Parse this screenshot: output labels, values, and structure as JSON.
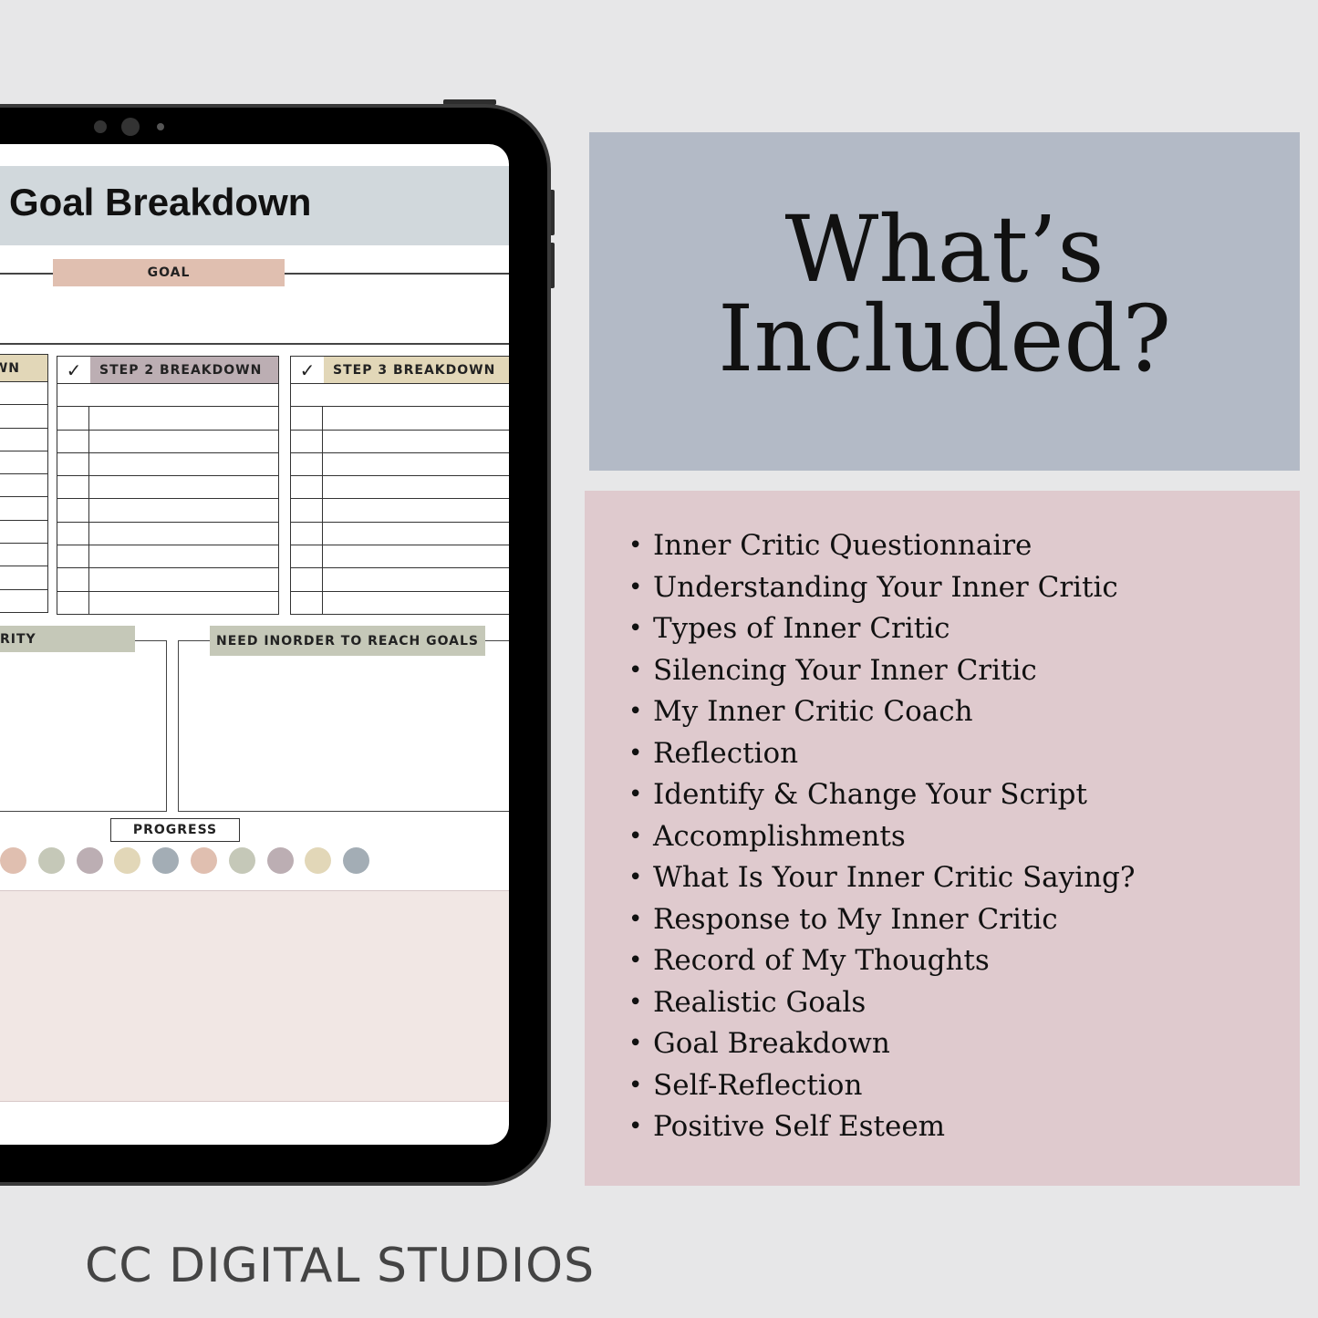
{
  "tablet_page": {
    "title": "Goal Breakdown",
    "goal_label": "GOAL",
    "steps": [
      {
        "label": "WN",
        "check": "✓"
      },
      {
        "label": "STEP 2 BREAKDOWN",
        "check": "✓"
      },
      {
        "label": "STEP 3 BREAKDOWN",
        "check": "✓"
      }
    ],
    "priority_label": "RITY",
    "need_label": "NEED INORDER TO REACH GOALS",
    "progress_label": "PROGRESS",
    "progress_dot_colors": [
      "#e0bfb0",
      "#c5c8b8",
      "#bcaeb3",
      "#e2d7b8",
      "#a3adb5",
      "#e0bfb0",
      "#c5c8b8",
      "#bcaeb3",
      "#e2d7b8",
      "#a3adb5"
    ]
  },
  "heading": {
    "line1": "What’s",
    "line2": "Included?"
  },
  "included": [
    "Inner Critic Questionnaire",
    "Understanding Your Inner Critic",
    "Types of Inner Critic",
    "Silencing Your Inner Critic",
    "My Inner Critic Coach",
    "Reflection",
    "Identify & Change Your Script",
    "Accomplishments",
    "What Is Your Inner Critic Saying?",
    "Response to My Inner Critic",
    "Record of My Thoughts",
    "Realistic Goals",
    "Goal Breakdown",
    "Self-Reflection",
    "Positive Self Esteem"
  ],
  "footer": "CC DIGITAL STUDIOS",
  "colors": {
    "background": "#e7e7e8",
    "heading_box": "#b3bac6",
    "list_box": "#dfcace",
    "goal": "#e0bfb0",
    "sage": "#c5c8b8",
    "mauve": "#bcaeb3",
    "sand": "#e2d7b8",
    "slate": "#a3adb5",
    "blush_panel": "#f1e7e4"
  }
}
